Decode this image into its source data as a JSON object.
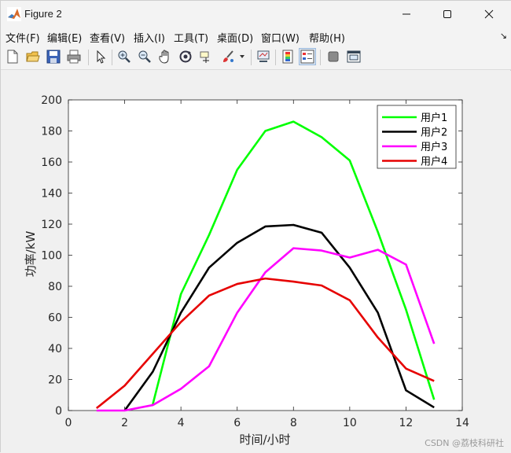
{
  "window": {
    "title": "Figure 2"
  },
  "menu": [
    "文件(F)",
    "编辑(E)",
    "查看(V)",
    "插入(I)",
    "工具(T)",
    "桌面(D)",
    "窗口(W)",
    "帮助(H)"
  ],
  "toolbar": {
    "icons": [
      "new-figure-icon",
      "open-file-icon",
      "save-icon",
      "print-icon",
      "pointer-icon",
      "zoom-in-icon",
      "zoom-out-icon",
      "pan-icon",
      "rotate-3d-icon",
      "data-cursor-icon",
      "brush-icon",
      "link-plot-icon",
      "colorbar-icon",
      "legend-icon",
      "hide-plot-tools-icon",
      "show-plot-tools-icon"
    ]
  },
  "watermark": "CSDN @荔枝科研社",
  "colors": {
    "series1": "#00ff00",
    "series2": "#000000",
    "series3": "#ff00ff",
    "series4": "#e60000"
  },
  "chart_data": {
    "type": "line",
    "title": "",
    "xlabel": "时间/小时",
    "ylabel": "功率/kW",
    "xlim": [
      0,
      14
    ],
    "ylim": [
      0,
      200
    ],
    "xticks": [
      0,
      2,
      4,
      6,
      8,
      10,
      12,
      14
    ],
    "yticks": [
      0,
      20,
      40,
      60,
      80,
      100,
      120,
      140,
      160,
      180,
      200
    ],
    "grid": false,
    "legend_position": "top-right",
    "x": [
      1,
      2,
      3,
      4,
      5,
      6,
      7,
      8,
      9,
      10,
      11,
      12,
      13
    ],
    "series": [
      {
        "name": "用户1",
        "color": "#00ff00",
        "x": [
          3,
          4,
          5,
          6,
          7,
          8,
          9,
          10,
          11,
          12,
          13
        ],
        "values": [
          4,
          75,
          113,
          155,
          180,
          186,
          176,
          161,
          115,
          65,
          7
        ]
      },
      {
        "name": "用户2",
        "color": "#000000",
        "x": [
          2,
          3,
          4,
          5,
          6,
          7,
          8,
          9,
          10,
          11,
          12,
          13
        ],
        "values": [
          0,
          25,
          63,
          92,
          108,
          118.5,
          119.5,
          114.5,
          92,
          63,
          13,
          2
        ]
      },
      {
        "name": "用户3",
        "color": "#ff00ff",
        "x": [
          1,
          2,
          3,
          4,
          5,
          6,
          7,
          8,
          9,
          10,
          11,
          12,
          13
        ],
        "values": [
          0,
          0,
          3.5,
          14,
          28.5,
          63,
          89,
          104.5,
          103,
          98.5,
          103.5,
          94,
          43
        ]
      },
      {
        "name": "用户4",
        "color": "#e60000",
        "x": [
          1,
          2,
          3,
          4,
          5,
          6,
          7,
          8,
          9,
          10,
          11,
          12,
          13
        ],
        "values": [
          1.5,
          16,
          36.5,
          57,
          74,
          81.5,
          85,
          83,
          80.5,
          71,
          47,
          27,
          19
        ]
      }
    ]
  }
}
